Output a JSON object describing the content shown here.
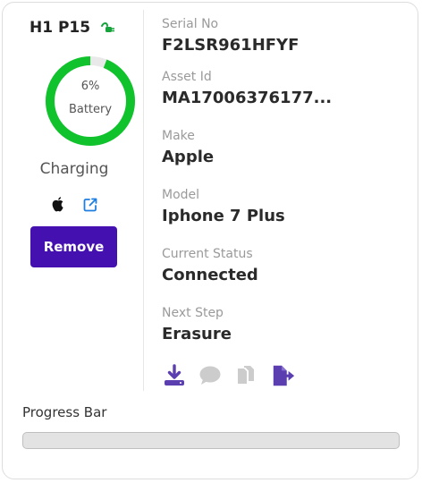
{
  "device": {
    "title": "H1 P15",
    "battery_percent_text": "6%",
    "battery_percent": 6,
    "battery_label": "Battery",
    "charging_text": "Charging",
    "remove_label": "Remove"
  },
  "fields": [
    {
      "label": "Serial No",
      "value": "F2LSR961HFYF"
    },
    {
      "label": "Asset Id",
      "value": "MA17006376177..."
    },
    {
      "label": "Make",
      "value": "Apple"
    },
    {
      "label": "Model",
      "value": "Iphone 7 Plus"
    },
    {
      "label": "Current Status",
      "value": "Connected"
    },
    {
      "label": "Next Step",
      "value": "Erasure"
    }
  ],
  "actions": [
    {
      "icon": "download-icon",
      "enabled": true
    },
    {
      "icon": "comment-icon",
      "enabled": false
    },
    {
      "icon": "copy-icon",
      "enabled": false
    },
    {
      "icon": "file-export-icon",
      "enabled": true
    }
  ],
  "progress": {
    "label": "Progress Bar",
    "value": 0
  },
  "colors": {
    "accent": "#4410b0",
    "action_icon": "#5b3fb0",
    "disabled_icon": "#cccccc",
    "battery_green": "#10c22c",
    "battery_track": "#e9e9e9",
    "charging_icon": "#17a33b"
  }
}
